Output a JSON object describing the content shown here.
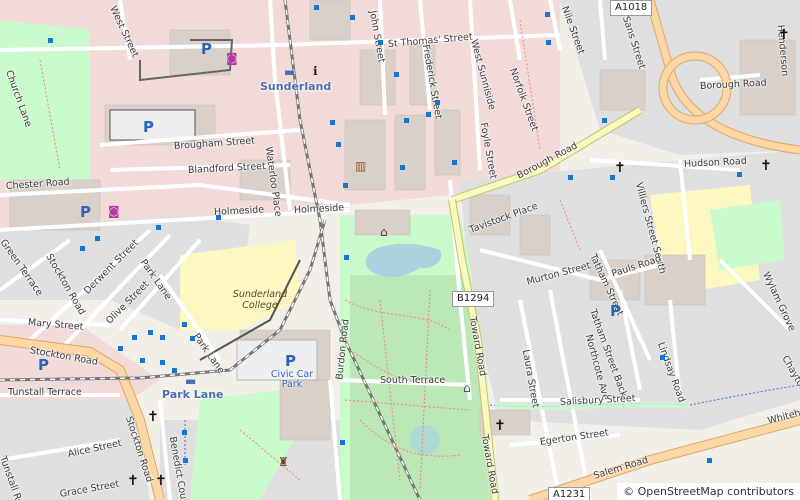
{
  "colors": {
    "background": "#f2efe9",
    "residential": "#e0dfdf",
    "commercial": "#f2dad9",
    "building": "#d9d0c9",
    "park": "#c8facc",
    "parkDark": "#add19e",
    "education": "#fdf8c2",
    "water": "#aad3df",
    "primary": "#fcd6a4",
    "secondary": "#f7fabf",
    "rail": "#777777",
    "parking": "#eeeeee",
    "busStop": "#1478d2",
    "footpath": "#fa8072"
  },
  "attribution": "© OpenStreetMap contributors",
  "places": [
    {
      "name": "Sunderland"
    },
    {
      "name": "Park Lane"
    }
  ],
  "areaLabels": {
    "college": "Sunderland College",
    "carPark": "Civic Car Park"
  },
  "routeShields": [
    "A1018",
    "B1294",
    "A1231"
  ],
  "streets": [
    "West Street",
    "John Street",
    "Frederick Street",
    "St Thomas' Street",
    "West Sunniside",
    "Norfolk Street",
    "Nile Street",
    "Foyle Street",
    "Borough Road",
    "Borough Road",
    "Hudson Road",
    "Sans Street",
    "Villiers Street South",
    "Church Lane",
    "Chester Road",
    "Brougham Street",
    "Blandford Street",
    "Waterloo Place",
    "Holmeside",
    "Holmeside",
    "Green Terrace",
    "Stockton Road",
    "Derwent Street",
    "Park Lane",
    "Olive Street",
    "Mary Street",
    "Stockton Road",
    "Tunstall Terrace",
    "Alice Street",
    "Tavistock Place",
    "Murton Street",
    "Tatham Street",
    "Pauls Road",
    "Tatham Street Back",
    "Northcote Ave",
    "Toward Road",
    "Toward Road",
    "Burdon Road",
    "South Terrace",
    "Laura Street",
    "Salisbury Street",
    "Egerton Street",
    "Salem Road",
    "Lindsay Road",
    "Wylam Grove",
    "Chaytor",
    "Benedict Court",
    "Henderson",
    "Park Lane",
    "Tunstall Road",
    "Stockton Road",
    "Whitehall",
    "Grace Street"
  ],
  "icons": [
    "parking-icon",
    "church-icon",
    "museum-icon",
    "library-icon",
    "information-icon",
    "train-station-icon",
    "shop-icon",
    "bus-stop-icon",
    "monument-icon",
    "playground-icon"
  ]
}
